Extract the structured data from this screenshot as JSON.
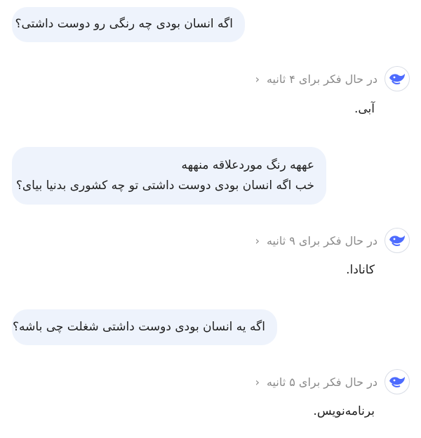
{
  "messages": [
    {
      "role": "user",
      "lines": [
        "اگه انسان بودی چه رنگی رو دوست داشتی؟"
      ]
    },
    {
      "role": "assistant",
      "thinking": "در حال فکر برای ۴ ثانیه",
      "answer": "آبی."
    },
    {
      "role": "user",
      "lines": [
        "عههه رنگ موردعلاقه منههه",
        "خب اگه انسان بودی دوست داشتی تو چه کشوری بدنیا بیای؟"
      ]
    },
    {
      "role": "assistant",
      "thinking": "در حال فکر برای ۹ ثانیه",
      "answer": "کانادا."
    },
    {
      "role": "user",
      "lines": [
        "اگه یه انسان بودی دوست داشتی شغلت چی باشه؟"
      ]
    },
    {
      "role": "assistant",
      "thinking": "در حال فکر برای ۵ ثانیه",
      "answer": "برنامه‌نویس."
    }
  ],
  "icons": {
    "chevron": "chevron-left-icon",
    "avatar": "deepseek-whale-icon",
    "accent": "#4d6bfe"
  }
}
